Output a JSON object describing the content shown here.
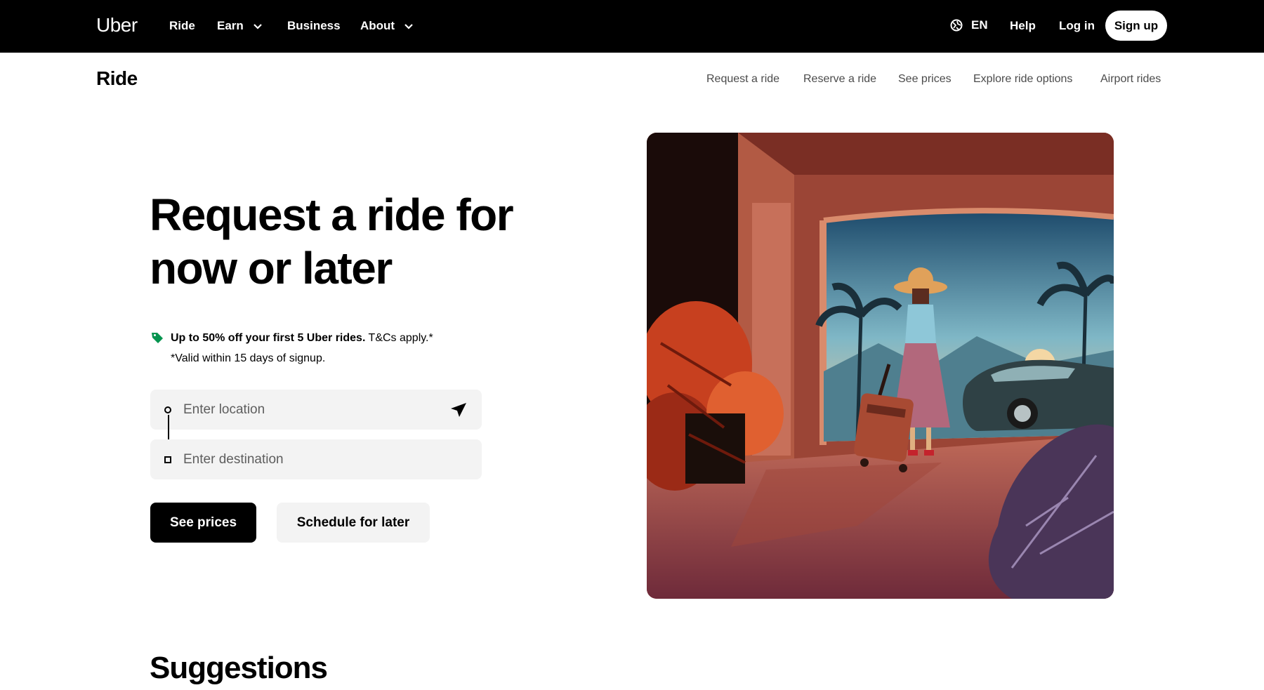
{
  "topbar": {
    "logo": "Uber",
    "nav": {
      "ride": "Ride",
      "earn": "Earn",
      "business": "Business",
      "about": "About"
    },
    "language": "EN",
    "help": "Help",
    "login": "Log in",
    "signup": "Sign up"
  },
  "subnav": {
    "title": "Ride",
    "links": [
      "Request a ride",
      "Reserve a ride",
      "See prices",
      "Explore ride options",
      "Airport rides"
    ]
  },
  "hero": {
    "title_line1": "Request a ride for",
    "title_line2": "now or later",
    "promo_bold": "Up to 50% off your first 5 Uber rides.",
    "promo_rest": " T&Cs apply.*",
    "promo_sub": "*Valid within 15 days of signup.",
    "location_placeholder": "Enter location",
    "destination_placeholder": "Enter destination",
    "see_prices": "See prices",
    "schedule": "Schedule for later"
  },
  "suggestions": {
    "title": "Suggestions"
  },
  "icons": {
    "promo": "tag-icon",
    "locate": "navigation-arrow-icon",
    "language": "globe-icon",
    "dropdown": "chevron-down-icon"
  },
  "colors": {
    "topbar": "#000000",
    "promo_tag": "#05944f",
    "field_bg": "#f3f3f3"
  }
}
